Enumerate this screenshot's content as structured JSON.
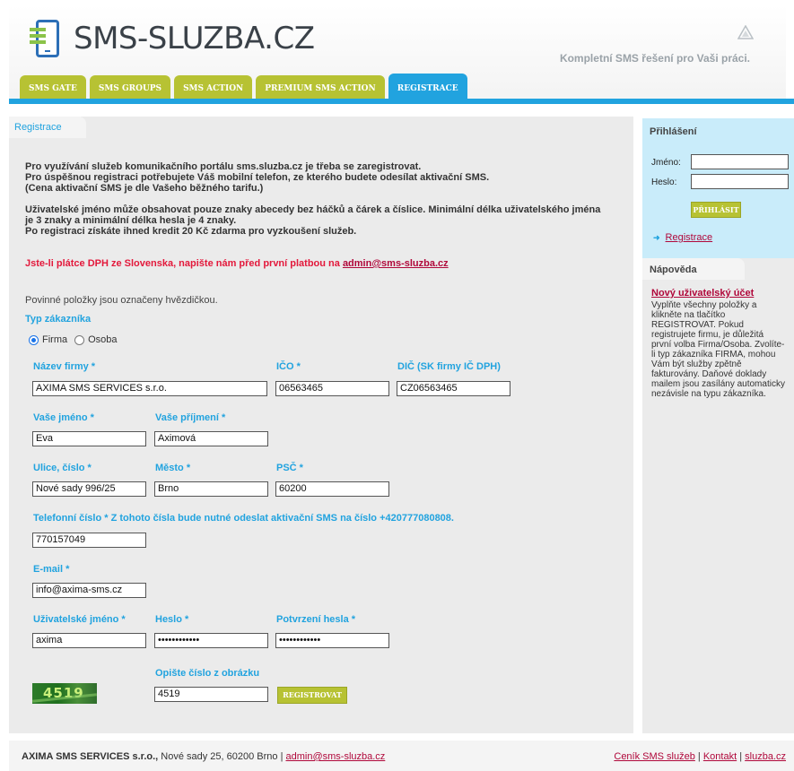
{
  "header": {
    "logo_text": "SMS-SLUZBA.CZ",
    "tagline": "Kompletní SMS řešení pro Vaši práci."
  },
  "tabs": [
    {
      "label": "SMS GATE",
      "active": false
    },
    {
      "label": "SMS GROUPS",
      "active": false
    },
    {
      "label": "SMS ACTION",
      "active": false
    },
    {
      "label": "PREMIUM SMS ACTION",
      "active": false
    },
    {
      "label": "REGISTRACE",
      "active": true
    }
  ],
  "main": {
    "tab_label": "Registrace",
    "intro1": "Pro využívání služeb komunikačního portálu sms.sluzba.cz je třeba se zaregistrovat.",
    "intro2": "Pro úspěšnou registraci potřebujete Váš mobilní telefon, ze kterého budete odesílat aktivační SMS.",
    "intro3": "(Cena aktivační SMS je dle Vašeho běžného tarifu.)",
    "intro4": "Uživatelské jméno může obsahovat pouze znaky abecedy bez háčků a čárek a číslice. Minimální délka uživatelského jména je 3 znaky a minimální délka hesla je 4 znaky.",
    "intro5": "Po registraci získáte ihned kredit 20 Kč zdarma pro vyzkoušení služeb.",
    "warning": "Jste-li plátce DPH ze Slovenska, napište nám před první platbou na ",
    "warning_email": "admin@sms-sluzba.cz",
    "required_note": "Povinné položky jsou označeny hvězdičkou.",
    "customer_type_title": "Typ zákazníka",
    "radio_firma": "Firma",
    "radio_osoba": "Osoba"
  },
  "form": {
    "company_label": "Název firmy *",
    "company_value": "AXIMA SMS SERVICES s.r.o.",
    "ico_label": "IČO *",
    "ico_value": "06563465",
    "dic_label": "DIČ (SK firmy IČ DPH)",
    "dic_value": "CZ06563465",
    "name_label": "Vaše jméno *",
    "name_value": "Eva",
    "surname_label": "Vaše příjmení *",
    "surname_value": "Aximová",
    "street_label": "Ulice, číslo *",
    "street_value": "Nové sady 996/25",
    "city_label": "Město *",
    "city_value": "Brno",
    "zip_label": "PSČ *",
    "zip_value": "60200",
    "phone_label": "Telefonní číslo * Z tohoto čísla bude nutné odeslat aktivační SMS na číslo +420777080808.",
    "phone_value": "770157049",
    "email_label": "E-mail *",
    "email_value": "info@axima-sms.cz",
    "username_label": "Uživatelské jméno *",
    "username_value": "axima",
    "password_label": "Heslo *",
    "password_value": "••••••••••••",
    "password_confirm_label": "Potvrzení hesla *",
    "password_confirm_value": "••••••••••••",
    "captcha_label": "Opište číslo z obrázku",
    "captcha_image_text": "4519",
    "captcha_value": "4519",
    "submit_label": "REGISTROVAT"
  },
  "sidebar": {
    "login_title": "Přihlášení",
    "username_label": "Jméno:",
    "password_label": "Heslo:",
    "login_button": "PŘIHLÁSIT",
    "register_link": "Registrace",
    "help_title": "Nápověda",
    "help_heading": "Nový uživatelský účet",
    "help_text": "Vyplňte všechny položky a klikněte na tlačítko REGISTROVAT. Pokud registrujete firmu, je důležitá první volba Firma/Osoba. Zvolíte-li typ zákazníka FIRMA, mohou Vám být služby zpětně fakturovány. Daňové doklady mailem jsou zasílány automaticky nezávisle na typu zákazníka."
  },
  "footer": {
    "company": "AXIMA SMS SERVICES s.r.o.,",
    "address": " Nové sady 25, 60200 Brno | ",
    "email": "admin@sms-sluzba.cz",
    "link_prices": "Ceník SMS služeb",
    "link_contact": "Kontakt",
    "link_site": "sluzba.cz",
    "separator": " | "
  },
  "colors": {
    "accent_blue": "#21a3df",
    "tab_green": "#b7c233",
    "warning_red": "#e3183b",
    "link_maroon": "#b0073a"
  }
}
